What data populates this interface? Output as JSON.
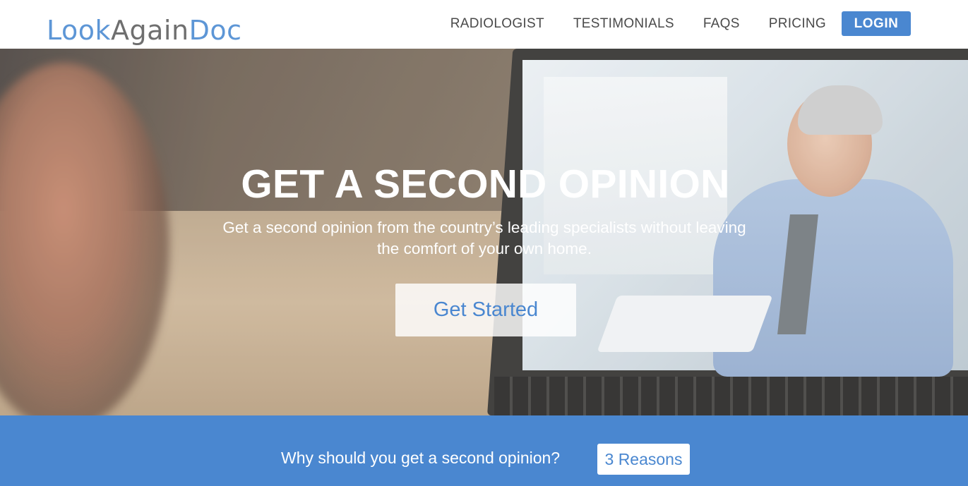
{
  "header": {
    "logo": {
      "part1": "Look",
      "part2": "Again",
      "part3": "Doc"
    },
    "nav": {
      "items": [
        {
          "label": "RADIOLOGIST"
        },
        {
          "label": "TESTIMONIALS"
        },
        {
          "label": "FAQS"
        },
        {
          "label": "PRICING"
        }
      ],
      "login_label": "LOGIN"
    }
  },
  "hero": {
    "title": "GET A SECOND OPINION",
    "subtitle_line1": "Get a second opinion from the country’s leading specialists without leaving",
    "subtitle_line2": "the comfort of your own home.",
    "cta_label": "Get Started"
  },
  "band": {
    "text": "Why should you get a second opinion?",
    "button_label": "3 Reasons"
  },
  "colors": {
    "accent": "#4a87d0",
    "logo_blue": "#5d96d6",
    "logo_gray": "#6f6f6f",
    "nav_text": "#4a4a4a"
  }
}
